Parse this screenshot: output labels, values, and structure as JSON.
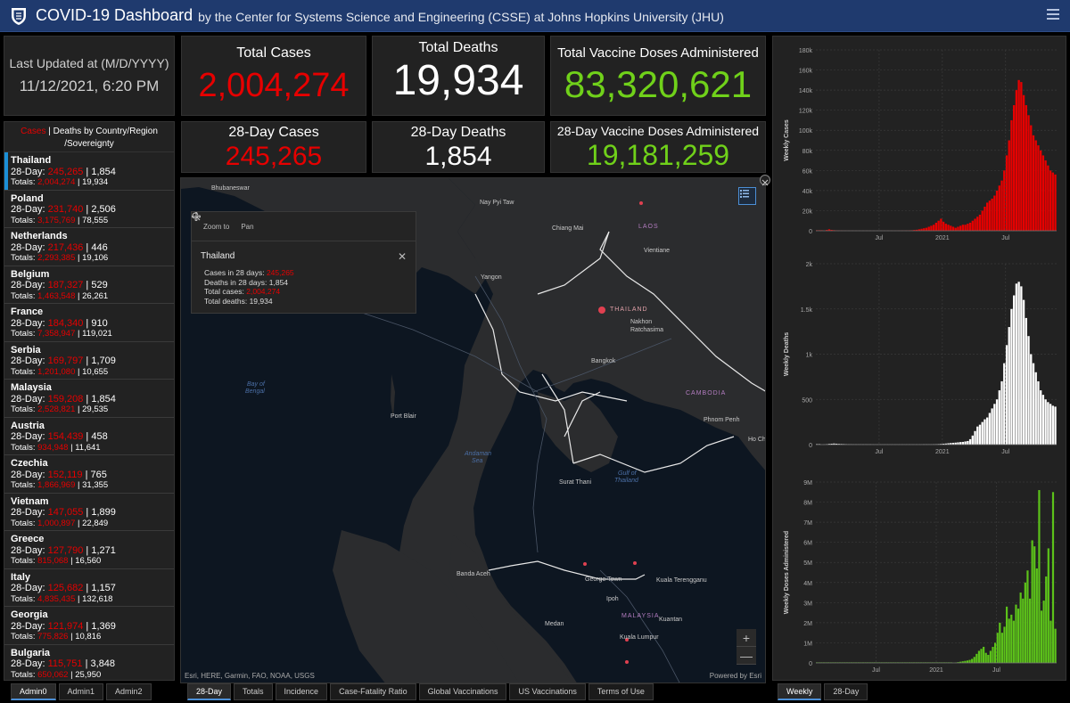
{
  "header": {
    "title": "COVID-19 Dashboard",
    "subtitle": "by the Center for Systems Science and Engineering (CSSE) at Johns Hopkins University (JHU)"
  },
  "last_updated": {
    "label": "Last Updated at (M/D/YYYY)",
    "value": "11/12/2021, 6:20 PM"
  },
  "stats": {
    "total_cases": {
      "label": "Total Cases",
      "value": "2,004,274"
    },
    "total_deaths": {
      "label": "Total Deaths",
      "value": "19,934"
    },
    "total_vaccines": {
      "label": "Total Vaccine Doses Administered",
      "value": "83,320,621"
    },
    "cases_28": {
      "label": "28-Day Cases",
      "value": "245,265"
    },
    "deaths_28": {
      "label": "28-Day Deaths",
      "value": "1,854"
    },
    "vaccines_28": {
      "label": "28-Day Vaccine Doses Administered",
      "value": "19,181,259"
    }
  },
  "country_list": {
    "header_cases": "Cases",
    "header_sep": " | ",
    "header_rest": "Deaths by Country/Region /Sovereignty",
    "prefix_28": "28-Day: ",
    "prefix_tot": "Totals: ",
    "items": [
      {
        "name": "Thailand",
        "c28": "245,265",
        "d28": "1,854",
        "ct": "2,004,274",
        "dt": "19,934"
      },
      {
        "name": "Poland",
        "c28": "231,740",
        "d28": "2,506",
        "ct": "3,175,769",
        "dt": "78,555"
      },
      {
        "name": "Netherlands",
        "c28": "217,436",
        "d28": "446",
        "ct": "2,293,385",
        "dt": "19,106"
      },
      {
        "name": "Belgium",
        "c28": "187,327",
        "d28": "529",
        "ct": "1,463,548",
        "dt": "26,261"
      },
      {
        "name": "France",
        "c28": "184,340",
        "d28": "910",
        "ct": "7,358,947",
        "dt": "119,021"
      },
      {
        "name": "Serbia",
        "c28": "169,797",
        "d28": "1,709",
        "ct": "1,201,080",
        "dt": "10,655"
      },
      {
        "name": "Malaysia",
        "c28": "159,208",
        "d28": "1,854",
        "ct": "2,528,821",
        "dt": "29,535"
      },
      {
        "name": "Austria",
        "c28": "154,439",
        "d28": "458",
        "ct": "934,948",
        "dt": "11,641"
      },
      {
        "name": "Czechia",
        "c28": "152,119",
        "d28": "765",
        "ct": "1,866,969",
        "dt": "31,355"
      },
      {
        "name": "Vietnam",
        "c28": "147,055",
        "d28": "1,899",
        "ct": "1,000,897",
        "dt": "22,849"
      },
      {
        "name": "Greece",
        "c28": "127,790",
        "d28": "1,271",
        "ct": "815,068",
        "dt": "16,560"
      },
      {
        "name": "Italy",
        "c28": "125,682",
        "d28": "1,157",
        "ct": "4,835,435",
        "dt": "132,618"
      },
      {
        "name": "Georgia",
        "c28": "121,974",
        "d28": "1,369",
        "ct": "775,826",
        "dt": "10,816"
      },
      {
        "name": "Bulgaria",
        "c28": "115,751",
        "d28": "3,848",
        "ct": "650,062",
        "dt": "25,950"
      }
    ]
  },
  "map": {
    "labels": {
      "bhubaneswar": "Bhubaneswar",
      "naypyitaw": "Nay Pyi Taw",
      "chiangmai": "Chiang Mai",
      "laos": "LAOS",
      "vientiane": "Vientiane",
      "yangon": "Yangon",
      "thailand": "THAILAND",
      "nakhon": "Nakhon",
      "ratchasima": "Ratchasima",
      "bangkok": "Bangkok",
      "bay1": "Bay of",
      "bay2": "Bengal",
      "cambodia": "CAMBODIA",
      "phnompenh": "Phnom Penh",
      "hochi": "Ho Ch",
      "portblair": "Port Blair",
      "andaman1": "Andaman",
      "andaman2": "Sea",
      "suratthani": "Surat Thani",
      "gulf1": "Gulf of",
      "gulf2": "Thailand",
      "bandaaceh": "Banda Aceh",
      "georgetown": "George Town",
      "kualaterengganu": "Kuala Terengganu",
      "ipoh": "Ipoh",
      "malaysia": "MALAYSIA",
      "kuantan": "Kuantan",
      "medan": "Medan",
      "kualalumpur": "Kuala Lumpur"
    },
    "attribution": "Esri, HERE, Garmin, FAO, NOAA, USGS",
    "powered_by": "Powered by Esri",
    "zoom_in": "+",
    "zoom_out": "—"
  },
  "popup": {
    "zoom_to": "Zoom to",
    "pan": "Pan",
    "title": "Thailand",
    "close": "✕",
    "l1_label": "Cases in 28 days: ",
    "l1_value": "245,265",
    "l2_label": "Deaths in 28 days: ",
    "l2_value": "1,854",
    "l3_label": "Total cases: ",
    "l3_value": "2,004,274",
    "l4_label": "Total deaths: ",
    "l4_value": "19,934"
  },
  "left_tabs": [
    {
      "label": "Admin0",
      "active": true
    },
    {
      "label": "Admin1",
      "active": false
    },
    {
      "label": "Admin2",
      "active": false
    }
  ],
  "map_tabs": [
    {
      "label": "28-Day",
      "active": true
    },
    {
      "label": "Totals",
      "active": false
    },
    {
      "label": "Incidence",
      "active": false
    },
    {
      "label": "Case-Fatality Ratio",
      "active": false
    },
    {
      "label": "Global Vaccinations",
      "active": false
    },
    {
      "label": "US Vaccinations",
      "active": false
    },
    {
      "label": "Terms of Use",
      "active": false
    }
  ],
  "chart_tabs": [
    {
      "label": "Weekly",
      "active": true
    },
    {
      "label": "28-Day",
      "active": false
    }
  ],
  "colors": {
    "cases": "#e60000",
    "deaths": "#ffffff",
    "vaccines": "#5cc21a",
    "header": "#1f3a6e",
    "accent": "#1b8fd6"
  },
  "chart_data": [
    {
      "type": "bar",
      "ylabel": "Weekly Cases",
      "ylim": [
        0,
        180000
      ],
      "yticks": [
        "0",
        "20k",
        "40k",
        "60k",
        "80k",
        "100k",
        "120k",
        "140k",
        "160k",
        "180k"
      ],
      "xticks": [
        {
          "label": "Jul",
          "at": 26
        },
        {
          "label": "2021",
          "at": 52
        },
        {
          "label": "Jul",
          "at": 78
        }
      ],
      "color": "#e60000",
      "values": [
        0,
        0,
        0,
        200,
        800,
        1500,
        900,
        600,
        400,
        300,
        200,
        150,
        120,
        100,
        90,
        80,
        70,
        60,
        50,
        60,
        70,
        80,
        60,
        50,
        40,
        40,
        50,
        60,
        70,
        80,
        90,
        100,
        100,
        120,
        150,
        200,
        250,
        300,
        400,
        500,
        800,
        1000,
        1500,
        2000,
        2500,
        3000,
        4000,
        5000,
        6000,
        8000,
        10000,
        12000,
        9000,
        7000,
        6000,
        5000,
        4000,
        3000,
        4000,
        5000,
        6000,
        6000,
        7000,
        8000,
        10000,
        12000,
        14000,
        16000,
        20000,
        24000,
        28000,
        30000,
        32000,
        35000,
        40000,
        45000,
        50000,
        60000,
        75000,
        90000,
        110000,
        125000,
        140000,
        150000,
        148000,
        135000,
        125000,
        115000,
        105000,
        95000,
        90000,
        85000,
        80000,
        75000,
        70000,
        65000,
        60000,
        58000,
        56000
      ]
    },
    {
      "type": "bar",
      "ylabel": "Weekly Deaths",
      "ylim": [
        0,
        2000
      ],
      "yticks": [
        "0",
        "500",
        "1k",
        "1.5k",
        "2k"
      ],
      "xticks": [
        {
          "label": "Jul",
          "at": 26
        },
        {
          "label": "2021",
          "at": 52
        },
        {
          "label": "Jul",
          "at": 78
        }
      ],
      "color": "#ffffff",
      "values": [
        0,
        0,
        1,
        2,
        5,
        8,
        10,
        12,
        10,
        8,
        7,
        6,
        5,
        4,
        4,
        3,
        3,
        3,
        3,
        3,
        3,
        3,
        3,
        2,
        2,
        2,
        2,
        2,
        2,
        2,
        2,
        2,
        2,
        2,
        2,
        2,
        2,
        2,
        2,
        2,
        2,
        2,
        2,
        2,
        3,
        3,
        3,
        3,
        4,
        5,
        6,
        8,
        10,
        12,
        15,
        18,
        20,
        22,
        25,
        28,
        30,
        35,
        40,
        60,
        100,
        150,
        200,
        220,
        250,
        280,
        300,
        350,
        400,
        450,
        500,
        600,
        700,
        900,
        1100,
        1300,
        1500,
        1650,
        1780,
        1800,
        1750,
        1600,
        1400,
        1200,
        1000,
        900,
        800,
        700,
        600,
        550,
        500,
        470,
        450,
        430,
        420
      ]
    },
    {
      "type": "bar",
      "ylabel": "Weekly Doses Administered",
      "ylim": [
        0,
        9000000
      ],
      "yticks": [
        "0",
        "1M",
        "2M",
        "3M",
        "4M",
        "5M",
        "6M",
        "7M",
        "8M",
        "9M"
      ],
      "xticks": [
        {
          "label": "Jul",
          "at": 26
        },
        {
          "label": "2021",
          "at": 52
        },
        {
          "label": "Jul",
          "at": 78
        }
      ],
      "color": "#5cc21a",
      "values": [
        0,
        0,
        0,
        0,
        0,
        0,
        0,
        0,
        0,
        0,
        0,
        0,
        0,
        0,
        0,
        0,
        0,
        0,
        0,
        0,
        0,
        0,
        0,
        0,
        0,
        0,
        0,
        0,
        0,
        0,
        0,
        0,
        0,
        0,
        0,
        0,
        0,
        0,
        0,
        0,
        0,
        0,
        0,
        0,
        0,
        0,
        0,
        0,
        0,
        0,
        0,
        0,
        0,
        0,
        0,
        0,
        0,
        0,
        0,
        10000,
        20000,
        40000,
        60000,
        80000,
        100000,
        120000,
        150000,
        200000,
        300000,
        450000,
        600000,
        700000,
        800000,
        500000,
        400000,
        600000,
        800000,
        1000000,
        1500000,
        2000000,
        1500000,
        1800000,
        2800000,
        2200000,
        2400000,
        2100000,
        2900000,
        2700000,
        3500000,
        3200000,
        4000000,
        4600000,
        3200000,
        6100000,
        5800000,
        4700000,
        8600000,
        2600000,
        3100000,
        4300000,
        5700000,
        2100000,
        8500000,
        1700000
      ]
    }
  ]
}
